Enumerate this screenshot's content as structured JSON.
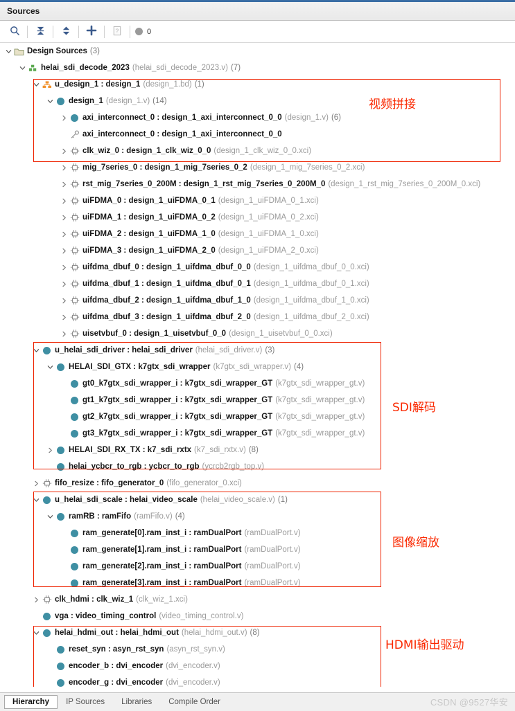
{
  "panel": {
    "title": "Sources"
  },
  "toolbar": {
    "search_icon": "search-icon",
    "collapse_all_icon": "collapse-all-icon",
    "expand_all_icon": "expand-collapse-icon",
    "add_icon": "add-sources-icon",
    "help_icon": "help-icon",
    "status_count": "0"
  },
  "tabs": [
    {
      "label": "Hierarchy",
      "active": true
    },
    {
      "label": "IP Sources",
      "active": false
    },
    {
      "label": "Libraries",
      "active": false
    },
    {
      "label": "Compile Order",
      "active": false
    }
  ],
  "watermark": "CSDN @9527华安",
  "annotations": [
    {
      "text": "视频拼接",
      "name": "annotation-video-splice"
    },
    {
      "text": "SDI解码",
      "name": "annotation-sdi-decode"
    },
    {
      "text": "图像缩放",
      "name": "annotation-image-scale"
    },
    {
      "text": "HDMI输出驱动",
      "name": "annotation-hdmi-output-driver"
    }
  ],
  "colors": {
    "accent_red": "#ee2200",
    "node_teal": "#3f8fa3",
    "bd_orange": "#f0902a",
    "title_blue": "#3a6ea5"
  },
  "tree": [
    {
      "indent": 0,
      "twisty": "down",
      "icon": "folder-icon",
      "main": "Design Sources",
      "file": "",
      "count": "(3)"
    },
    {
      "indent": 1,
      "twisty": "down",
      "icon": "module-green-icon",
      "main": "helai_sdi_decode_2023",
      "file": "(helai_sdi_decode_2023.v)",
      "count": "(7)"
    },
    {
      "indent": 2,
      "twisty": "down",
      "icon": "block-design-icon",
      "main": "u_design_1 : design_1",
      "file": "(design_1.bd)",
      "count": "(1)"
    },
    {
      "indent": 3,
      "twisty": "down",
      "icon": "circle-icon",
      "main": "design_1",
      "file": "(design_1.v)",
      "count": "(14)"
    },
    {
      "indent": 4,
      "twisty": "right",
      "icon": "circle-icon",
      "main": "axi_interconnect_0 : design_1_axi_interconnect_0_0",
      "file": "(design_1.v)",
      "count": "(6)"
    },
    {
      "indent": 4,
      "twisty": "none",
      "icon": "key-icon",
      "main": "axi_interconnect_0 : design_1_axi_interconnect_0_0",
      "file": "",
      "count": ""
    },
    {
      "indent": 4,
      "twisty": "right",
      "icon": "ip-core-icon",
      "main": "clk_wiz_0 : design_1_clk_wiz_0_0",
      "file": "(design_1_clk_wiz_0_0.xci)",
      "count": ""
    },
    {
      "indent": 4,
      "twisty": "right",
      "icon": "ip-core-icon",
      "main": "mig_7series_0 : design_1_mig_7series_0_2",
      "file": "(design_1_mig_7series_0_2.xci)",
      "count": ""
    },
    {
      "indent": 4,
      "twisty": "right",
      "icon": "ip-core-icon",
      "main": "rst_mig_7series_0_200M : design_1_rst_mig_7series_0_200M_0",
      "file": "(design_1_rst_mig_7series_0_200M_0.xci)",
      "count": ""
    },
    {
      "indent": 4,
      "twisty": "right",
      "icon": "ip-core-icon",
      "main": "uiFDMA_0 : design_1_uiFDMA_0_1",
      "file": "(design_1_uiFDMA_0_1.xci)",
      "count": ""
    },
    {
      "indent": 4,
      "twisty": "right",
      "icon": "ip-core-icon",
      "main": "uiFDMA_1 : design_1_uiFDMA_0_2",
      "file": "(design_1_uiFDMA_0_2.xci)",
      "count": ""
    },
    {
      "indent": 4,
      "twisty": "right",
      "icon": "ip-core-icon",
      "main": "uiFDMA_2 : design_1_uiFDMA_1_0",
      "file": "(design_1_uiFDMA_1_0.xci)",
      "count": ""
    },
    {
      "indent": 4,
      "twisty": "right",
      "icon": "ip-core-icon",
      "main": "uiFDMA_3 : design_1_uiFDMA_2_0",
      "file": "(design_1_uiFDMA_2_0.xci)",
      "count": ""
    },
    {
      "indent": 4,
      "twisty": "right",
      "icon": "ip-core-icon",
      "main": "uifdma_dbuf_0 : design_1_uifdma_dbuf_0_0",
      "file": "(design_1_uifdma_dbuf_0_0.xci)",
      "count": ""
    },
    {
      "indent": 4,
      "twisty": "right",
      "icon": "ip-core-icon",
      "main": "uifdma_dbuf_1 : design_1_uifdma_dbuf_0_1",
      "file": "(design_1_uifdma_dbuf_0_1.xci)",
      "count": ""
    },
    {
      "indent": 4,
      "twisty": "right",
      "icon": "ip-core-icon",
      "main": "uifdma_dbuf_2 : design_1_uifdma_dbuf_1_0",
      "file": "(design_1_uifdma_dbuf_1_0.xci)",
      "count": ""
    },
    {
      "indent": 4,
      "twisty": "right",
      "icon": "ip-core-icon",
      "main": "uifdma_dbuf_3 : design_1_uifdma_dbuf_2_0",
      "file": "(design_1_uifdma_dbuf_2_0.xci)",
      "count": ""
    },
    {
      "indent": 4,
      "twisty": "right",
      "icon": "ip-core-icon",
      "main": "uisetvbuf_0 : design_1_uisetvbuf_0_0",
      "file": "(design_1_uisetvbuf_0_0.xci)",
      "count": ""
    },
    {
      "indent": 2,
      "twisty": "down",
      "icon": "circle-icon",
      "main": "u_helai_sdi_driver : helai_sdi_driver",
      "file": "(helai_sdi_driver.v)",
      "count": "(3)"
    },
    {
      "indent": 3,
      "twisty": "down",
      "icon": "circle-icon",
      "main": "HELAI_SDI_GTX : k7gtx_sdi_wrapper",
      "file": "(k7gtx_sdi_wrapper.v)",
      "count": "(4)"
    },
    {
      "indent": 4,
      "twisty": "none",
      "icon": "circle-icon",
      "main": "gt0_k7gtx_sdi_wrapper_i : k7gtx_sdi_wrapper_GT",
      "file": "(k7gtx_sdi_wrapper_gt.v)",
      "count": ""
    },
    {
      "indent": 4,
      "twisty": "none",
      "icon": "circle-icon",
      "main": "gt1_k7gtx_sdi_wrapper_i : k7gtx_sdi_wrapper_GT",
      "file": "(k7gtx_sdi_wrapper_gt.v)",
      "count": ""
    },
    {
      "indent": 4,
      "twisty": "none",
      "icon": "circle-icon",
      "main": "gt2_k7gtx_sdi_wrapper_i : k7gtx_sdi_wrapper_GT",
      "file": "(k7gtx_sdi_wrapper_gt.v)",
      "count": ""
    },
    {
      "indent": 4,
      "twisty": "none",
      "icon": "circle-icon",
      "main": "gt3_k7gtx_sdi_wrapper_i : k7gtx_sdi_wrapper_GT",
      "file": "(k7gtx_sdi_wrapper_gt.v)",
      "count": ""
    },
    {
      "indent": 3,
      "twisty": "right",
      "icon": "circle-icon",
      "main": "HELAI_SDI_RX_TX : k7_sdi_rxtx",
      "file": "(k7_sdi_rxtx.v)",
      "count": "(8)"
    },
    {
      "indent": 3,
      "twisty": "none",
      "icon": "circle-icon",
      "main": "helai_ycbcr_to_rgb : ycbcr_to_rgb",
      "file": "(ycrcb2rgb_top.v)",
      "count": ""
    },
    {
      "indent": 2,
      "twisty": "right",
      "icon": "ip-core-icon",
      "main": "fifo_resize : fifo_generator_0",
      "file": "(fifo_generator_0.xci)",
      "count": ""
    },
    {
      "indent": 2,
      "twisty": "down",
      "icon": "circle-icon",
      "main": "u_helai_sdi_scale : helai_video_scale",
      "file": "(helai_video_scale.v)",
      "count": "(1)"
    },
    {
      "indent": 3,
      "twisty": "down",
      "icon": "circle-icon",
      "main": "ramRB : ramFifo",
      "file": "(ramFifo.v)",
      "count": "(4)"
    },
    {
      "indent": 4,
      "twisty": "none",
      "icon": "circle-icon",
      "main": "ram_generate[0].ram_inst_i : ramDualPort",
      "file": "(ramDualPort.v)",
      "count": ""
    },
    {
      "indent": 4,
      "twisty": "none",
      "icon": "circle-icon",
      "main": "ram_generate[1].ram_inst_i : ramDualPort",
      "file": "(ramDualPort.v)",
      "count": ""
    },
    {
      "indent": 4,
      "twisty": "none",
      "icon": "circle-icon",
      "main": "ram_generate[2].ram_inst_i : ramDualPort",
      "file": "(ramDualPort.v)",
      "count": ""
    },
    {
      "indent": 4,
      "twisty": "none",
      "icon": "circle-icon",
      "main": "ram_generate[3].ram_inst_i : ramDualPort",
      "file": "(ramDualPort.v)",
      "count": ""
    },
    {
      "indent": 2,
      "twisty": "right",
      "icon": "ip-core-icon",
      "main": "clk_hdmi : clk_wiz_1",
      "file": "(clk_wiz_1.xci)",
      "count": ""
    },
    {
      "indent": 2,
      "twisty": "none",
      "icon": "circle-icon",
      "main": "vga : video_timing_control",
      "file": "(video_timing_control.v)",
      "count": ""
    },
    {
      "indent": 2,
      "twisty": "down",
      "icon": "circle-icon",
      "main": "helai_hdmi_out : helai_hdmi_out",
      "file": "(helai_hdmi_out.v)",
      "count": "(8)"
    },
    {
      "indent": 3,
      "twisty": "none",
      "icon": "circle-icon",
      "main": "reset_syn : asyn_rst_syn",
      "file": "(asyn_rst_syn.v)",
      "count": ""
    },
    {
      "indent": 3,
      "twisty": "none",
      "icon": "circle-icon",
      "main": "encoder_b : dvi_encoder",
      "file": "(dvi_encoder.v)",
      "count": ""
    },
    {
      "indent": 3,
      "twisty": "none",
      "icon": "circle-icon",
      "main": "encoder_g : dvi_encoder",
      "file": "(dvi_encoder.v)",
      "count": ""
    }
  ]
}
